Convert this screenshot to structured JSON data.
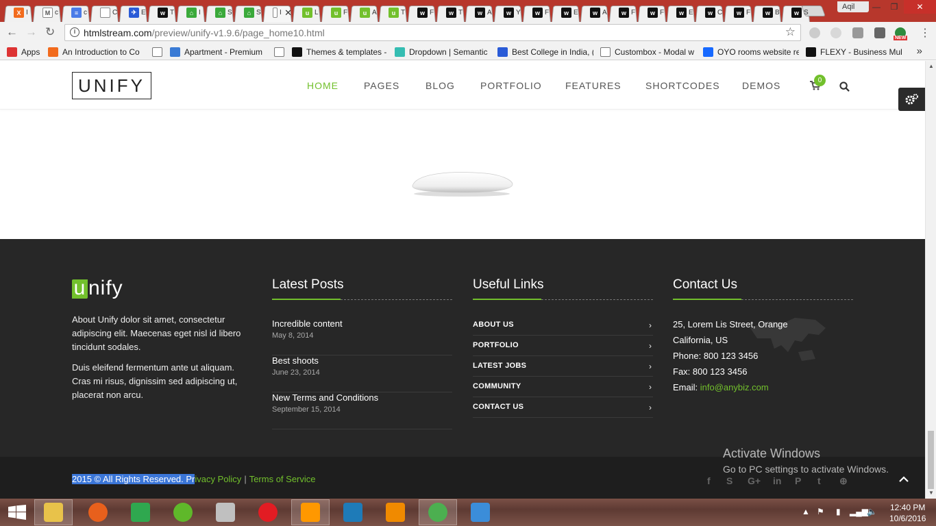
{
  "browser": {
    "tabs": [
      {
        "icon": "xampp-icon",
        "color": "#f26b1d",
        "glyph": "X",
        "title": "I"
      },
      {
        "icon": "gmail-icon",
        "color": "#ffffff",
        "glyph": "M",
        "title": "c"
      },
      {
        "icon": "docs-icon",
        "color": "#4a7be8",
        "glyph": "≡",
        "title": "c"
      },
      {
        "icon": "page-icon",
        "color": "#ffffff",
        "glyph": "",
        "title": "C"
      },
      {
        "icon": "semantic-icon",
        "color": "#2a5bd7",
        "glyph": "✈",
        "title": "E"
      },
      {
        "icon": "wix-icon",
        "color": "#111111",
        "glyph": "w",
        "title": "T"
      },
      {
        "icon": "home-icon",
        "color": "#3aa93a",
        "glyph": "⌂",
        "title": "I"
      },
      {
        "icon": "home-icon",
        "color": "#3aa93a",
        "glyph": "⌂",
        "title": "S"
      },
      {
        "icon": "home-icon",
        "color": "#3aa93a",
        "glyph": "⌂",
        "title": "S"
      },
      {
        "icon": "unify-icon",
        "color": "#ffffff",
        "glyph": "",
        "title": "I",
        "active": true
      },
      {
        "icon": "unify-green-icon",
        "color": "#72c02c",
        "glyph": "u",
        "title": "L"
      },
      {
        "icon": "unify-green-icon",
        "color": "#72c02c",
        "glyph": "u",
        "title": "F"
      },
      {
        "icon": "unify-green-icon",
        "color": "#72c02c",
        "glyph": "u",
        "title": "A"
      },
      {
        "icon": "unify-green-icon",
        "color": "#72c02c",
        "glyph": "u",
        "title": "T"
      },
      {
        "icon": "wix-icon",
        "color": "#111111",
        "glyph": "w",
        "title": "F"
      },
      {
        "icon": "wix-icon",
        "color": "#111111",
        "glyph": "w",
        "title": "T"
      },
      {
        "icon": "wix-icon",
        "color": "#111111",
        "glyph": "w",
        "title": "A"
      },
      {
        "icon": "wix-icon",
        "color": "#111111",
        "glyph": "w",
        "title": "Y"
      },
      {
        "icon": "wix-icon",
        "color": "#111111",
        "glyph": "w",
        "title": "F"
      },
      {
        "icon": "wix-icon",
        "color": "#111111",
        "glyph": "w",
        "title": "E"
      },
      {
        "icon": "wix-icon",
        "color": "#111111",
        "glyph": "w",
        "title": "A"
      },
      {
        "icon": "wix-icon",
        "color": "#111111",
        "glyph": "w",
        "title": "F"
      },
      {
        "icon": "wix-icon",
        "color": "#111111",
        "glyph": "w",
        "title": "F"
      },
      {
        "icon": "wix-icon",
        "color": "#111111",
        "glyph": "w",
        "title": "E"
      },
      {
        "icon": "wix-icon",
        "color": "#111111",
        "glyph": "w",
        "title": "C"
      },
      {
        "icon": "wix-icon",
        "color": "#111111",
        "glyph": "w",
        "title": "F"
      },
      {
        "icon": "wix-icon",
        "color": "#111111",
        "glyph": "w",
        "title": "B"
      },
      {
        "icon": "wix-icon",
        "color": "#111111",
        "glyph": "w",
        "title": "S"
      }
    ],
    "active_tab_close": "✕",
    "user": "Aqil",
    "url_host": "htmlstream.com",
    "url_path": "/preview/unify-v1.9.6/page_home10.html",
    "extension_badge": "NEW",
    "bookmarks": [
      {
        "label": "Apps",
        "icon": "apps-grid-icon",
        "color": "#d33"
      },
      {
        "label": "An Introduction to Co",
        "icon": "plus-box-icon",
        "color": "#f26b1d"
      },
      {
        "label": "",
        "icon": "page-icon",
        "color": "#ffffff"
      },
      {
        "label": "Apartment - Premium",
        "icon": "home-blue-icon",
        "color": "#3a7bd5"
      },
      {
        "label": "",
        "icon": "page-icon",
        "color": "#ffffff"
      },
      {
        "label": "Themes & templates -",
        "icon": "wix-icon",
        "color": "#111111"
      },
      {
        "label": "Dropdown | Semantic",
        "icon": "semantic-s-icon",
        "color": "#35bdb2"
      },
      {
        "label": "Best College in India, (",
        "icon": "plane-icon",
        "color": "#2a5bd7"
      },
      {
        "label": "Custombox - Modal w",
        "icon": "page-icon",
        "color": "#ffffff"
      },
      {
        "label": "OYO rooms website re",
        "icon": "behance-icon",
        "color": "#1769ff"
      },
      {
        "label": "FLEXY - Business Mult",
        "icon": "wix-icon",
        "color": "#111111"
      }
    ]
  },
  "site": {
    "logo": "UNIFY",
    "nav": [
      "HOME",
      "PAGES",
      "BLOG",
      "PORTFOLIO",
      "FEATURES",
      "SHORTCODES",
      "DEMOS"
    ],
    "active_nav": "HOME",
    "cart_count": "0",
    "accent": "#72c02c"
  },
  "footer": {
    "logo_first": "u",
    "logo_rest": "nify",
    "about": [
      "About Unify dolor sit amet, consectetur adipiscing elit. Maecenas eget nisl id libero tincidunt sodales.",
      "Duis eleifend fermentum ante ut aliquam. Cras mi risus, dignissim sed adipiscing ut, placerat non arcu."
    ],
    "latest_posts_title": "Latest Posts",
    "posts": [
      {
        "title": "Incredible content",
        "date": "May 8, 2014"
      },
      {
        "title": "Best shoots",
        "date": "June 23, 2014"
      },
      {
        "title": "New Terms and Conditions",
        "date": "September 15, 2014"
      }
    ],
    "useful_links_title": "Useful Links",
    "links": [
      "ABOUT US",
      "PORTFOLIO",
      "LATEST JOBS",
      "COMMUNITY",
      "CONTACT US"
    ],
    "contact_title": "Contact Us",
    "contact": {
      "address_line1": "25, Lorem Lis Street, Orange",
      "address_line2": "California, US",
      "phone": "Phone: 800 123 3456",
      "fax": "Fax: 800 123 3456",
      "email_label": "Email:",
      "email": "info@anybiz.com"
    },
    "copyright_selected": "2015 © All Rights Reserved. Pr",
    "copyright_rest": "ivacy Policy",
    "separator": "|",
    "terms": "Terms of Service",
    "social": [
      "f",
      "S",
      "G+",
      "in",
      "P",
      "t",
      "⊕"
    ]
  },
  "overlay": {
    "activate_title": "Activate Windows",
    "activate_sub": "Go to PC settings to activate Windows."
  },
  "taskbar": {
    "apps": [
      {
        "icon": "file-explorer-icon",
        "color": "#e8c24a",
        "on": true
      },
      {
        "icon": "firefox-icon",
        "color": "#e8601c"
      },
      {
        "icon": "store-icon",
        "color": "#2fa84f"
      },
      {
        "icon": "frog-icon",
        "color": "#5fb82a"
      },
      {
        "icon": "snipping-icon",
        "color": "#c0c0c0"
      },
      {
        "icon": "opera-icon",
        "color": "#e21c23"
      },
      {
        "icon": "sublime-icon",
        "color": "#ff9800",
        "on": true
      },
      {
        "icon": "terminal-icon",
        "color": "#1e7bb8"
      },
      {
        "icon": "vlc-icon",
        "color": "#f08a00"
      },
      {
        "icon": "chrome-icon",
        "color": "#4caf50",
        "on": true
      },
      {
        "icon": "photos-icon",
        "color": "#3b8dd9"
      }
    ],
    "time": "12:40 PM",
    "date": "10/6/2016"
  }
}
